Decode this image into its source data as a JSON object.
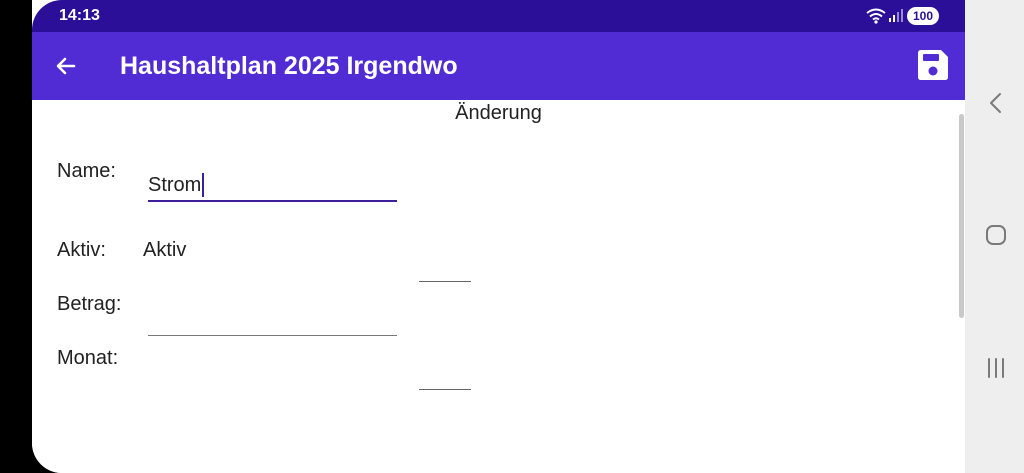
{
  "status_bar": {
    "time": "14:13",
    "battery": "100"
  },
  "app_bar": {
    "title": "Haushaltplan 2025 Irgendwo"
  },
  "form": {
    "heading": "Änderung",
    "name_label": "Name:",
    "name_value": "Strom",
    "active_label": "Aktiv:",
    "active_value": "Aktiv",
    "amount_label": "Betrag:",
    "amount_value": "",
    "month_label": "Monat:"
  },
  "icons": {
    "back": "arrow-left-icon",
    "save": "floppy-disk-icon",
    "nav_back": "chevron-left-icon",
    "nav_home": "rounded-square-icon",
    "nav_recents": "three-bars-icon"
  },
  "colors": {
    "status_bar": "#2b0f99",
    "app_bar": "#512bd4",
    "input_focus": "#3f1e9c",
    "nav_bar": "#eeeeef"
  }
}
